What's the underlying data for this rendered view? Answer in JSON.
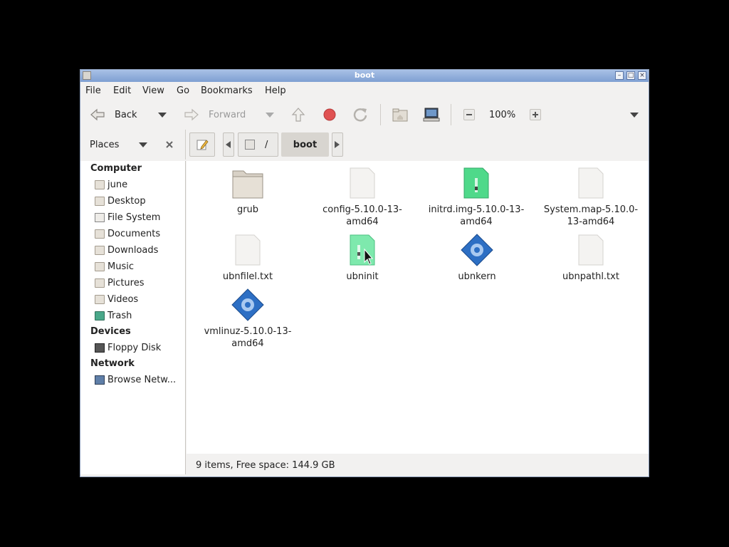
{
  "window": {
    "title": "boot"
  },
  "menu": [
    "File",
    "Edit",
    "View",
    "Go",
    "Bookmarks",
    "Help"
  ],
  "toolbar": {
    "back": "Back",
    "forward": "Forward",
    "zoom": "100%"
  },
  "addressbar": {
    "places_label": "Places",
    "path_root": "/",
    "path_current": "boot"
  },
  "sidebar": {
    "computer_header": "Computer",
    "computer_items": [
      "june",
      "Desktop",
      "File System",
      "Documents",
      "Downloads",
      "Music",
      "Pictures",
      "Videos",
      "Trash"
    ],
    "devices_header": "Devices",
    "devices_items": [
      "Floppy Disk"
    ],
    "network_header": "Network",
    "network_items": [
      "Browse Netw..."
    ]
  },
  "files": [
    {
      "name_lines": [
        "grub"
      ],
      "icon": "folder-icon"
    },
    {
      "name_lines": [
        "config-5.10.0-13-",
        "amd64"
      ],
      "icon": "text-file-icon"
    },
    {
      "name_lines": [
        "initrd.img-5.10.0-13-",
        "amd64"
      ],
      "icon": "archive-icon"
    },
    {
      "name_lines": [
        "System.map-5.10.0-",
        "13-amd64"
      ],
      "icon": "text-file-icon"
    },
    {
      "name_lines": [
        "ubnfilel.txt"
      ],
      "icon": "text-file-icon"
    },
    {
      "name_lines": [
        "ubninit"
      ],
      "icon": "archive-icon"
    },
    {
      "name_lines": [
        "ubnkern"
      ],
      "icon": "executable-icon"
    },
    {
      "name_lines": [
        "ubnpathl.txt"
      ],
      "icon": "text-file-icon"
    },
    {
      "name_lines": [
        "vmlinuz-5.10.0-13-",
        "amd64"
      ],
      "icon": "executable-icon"
    }
  ],
  "status": "9 items, Free space: 144.9 GB",
  "colors": {
    "titlebar": "#7e9fd2",
    "archive": "#4fd98a",
    "executable": "#2d6fc4",
    "stop": "#e05252"
  }
}
